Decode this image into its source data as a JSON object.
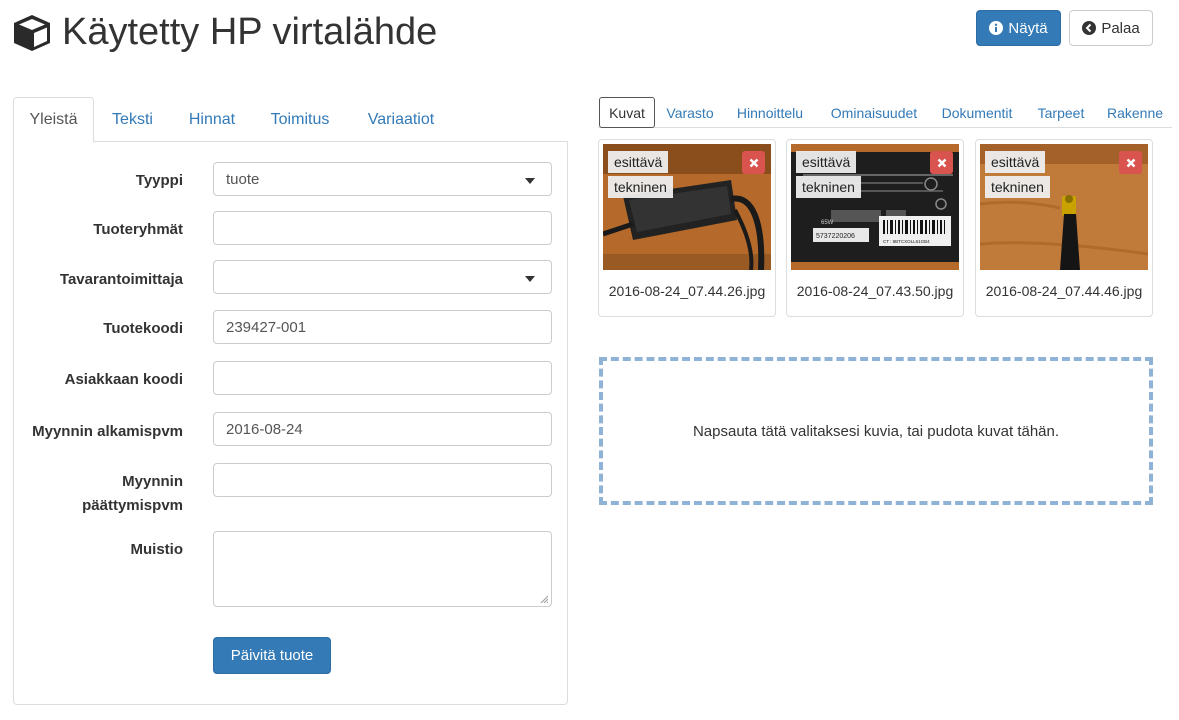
{
  "header": {
    "title": "Käytetty HP virtalähde",
    "show_label": "Näytä",
    "back_label": "Palaa"
  },
  "left_tabs": [
    "Yleistä",
    "Teksti",
    "Hinnat",
    "Toimitus",
    "Variaatiot"
  ],
  "form": {
    "type_label": "Tyyppi",
    "type_value": "tuote",
    "groups_label": "Tuoteryhmät",
    "groups_value": "",
    "supplier_label": "Tavarantoimittaja",
    "supplier_value": "",
    "code_label": "Tuotekoodi",
    "code_value": "239427-001",
    "customer_code_label": "Asiakkaan koodi",
    "customer_code_value": "",
    "sale_start_label": "Myynnin alkamispvm",
    "sale_start_value": "2016-08-24",
    "sale_end_label_line1": "Myynnin",
    "sale_end_label_line2": "päättymispvm",
    "sale_end_value": "",
    "memo_label": "Muistio",
    "update_label": "Päivitä tuote"
  },
  "right_tabs": [
    "Kuvat",
    "Varasto",
    "Hinnoittelu",
    "Ominaisuudet",
    "Dokumentit",
    "Tarpeet",
    "Rakenne"
  ],
  "images": [
    {
      "filename": "2016-08-24_07.44.26.jpg",
      "tag1": "esittävä",
      "tag2": "tekninen"
    },
    {
      "filename": "2016-08-24_07.43.50.jpg",
      "tag1": "esittävä",
      "tag2": "tekninen",
      "sticker1": "65W",
      "sticker2": "5737220206",
      "sticker3": "CT : 8BTCXOLL61GB4"
    },
    {
      "filename": "2016-08-24_07.44.46.jpg",
      "tag1": "esittävä",
      "tag2": "tekninen"
    }
  ],
  "dropzone_text": "Napsauta tätä valitaksesi kuvia, tai pudota kuvat tähän.",
  "icons": {
    "title": "cube-icon",
    "show": "info-circle-icon",
    "back": "chevron-circle-left-icon",
    "delete": "remove-icon",
    "select": "caret-down-icon"
  },
  "colors": {
    "primary": "#337ab7",
    "danger": "#d9534f",
    "dropzone_border": "#8fb3d6"
  }
}
